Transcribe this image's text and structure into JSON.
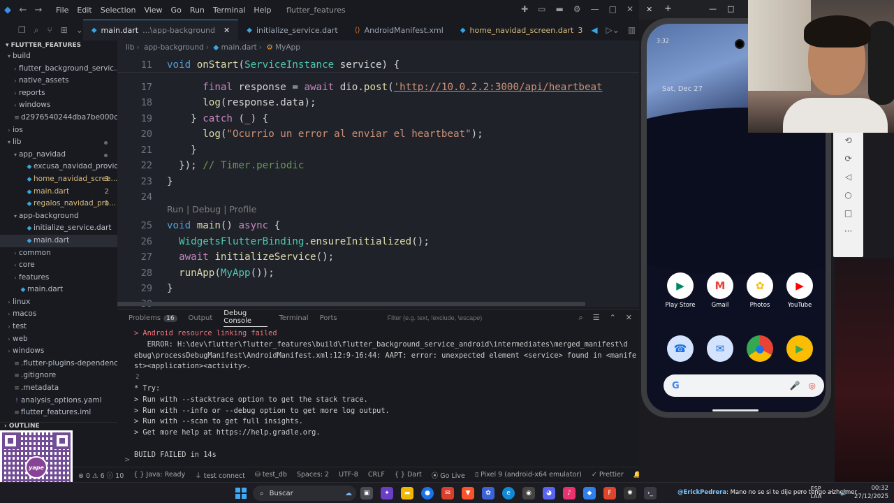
{
  "titlebar": {
    "menus": [
      "File",
      "Edit",
      "Selection",
      "View",
      "Go",
      "Run",
      "Terminal",
      "Help"
    ],
    "window_title": "flutter_features"
  },
  "tabs": [
    {
      "name": "main.dart",
      "desc": "...\\app-background",
      "active": true,
      "icon": "dart"
    },
    {
      "name": "initialize_service.dart",
      "icon": "dart"
    },
    {
      "name": "AndroidManifest.xml",
      "icon": "xml"
    },
    {
      "name": "home_navidad_screen.dart",
      "badge": "3",
      "icon": "dart"
    }
  ],
  "explorer": {
    "title": "FLUTTER_FEATURES",
    "outline": "OUTLINE",
    "items": [
      {
        "label": "build",
        "depth": 0,
        "type": "folder-open"
      },
      {
        "label": "flutter_background_servic...",
        "depth": 1,
        "type": "folder"
      },
      {
        "label": "native_assets",
        "depth": 1,
        "type": "folder"
      },
      {
        "label": "reports",
        "depth": 1,
        "type": "folder"
      },
      {
        "label": "windows",
        "depth": 1,
        "type": "folder"
      },
      {
        "label": "d2976540244dba7be000c4...",
        "depth": 0,
        "type": "file"
      },
      {
        "label": "ios",
        "depth": 0,
        "type": "folder"
      },
      {
        "label": "lib",
        "depth": 0,
        "type": "folder-open",
        "dot": true
      },
      {
        "label": "app_navidad",
        "depth": 1,
        "type": "folder-open",
        "dot": true
      },
      {
        "label": "excusa_navidad_provider....",
        "depth": 2,
        "type": "dart"
      },
      {
        "label": "home_navidad_scree...",
        "depth": 2,
        "type": "dart",
        "badge": "3",
        "warn": true
      },
      {
        "label": "main.dart",
        "depth": 2,
        "type": "dart",
        "badge": "2",
        "warn": true
      },
      {
        "label": "regalos_navidad_pro...",
        "depth": 2,
        "type": "dart",
        "badge": "1",
        "warn": true
      },
      {
        "label": "app-background",
        "depth": 1,
        "type": "folder-open"
      },
      {
        "label": "initialize_service.dart",
        "depth": 2,
        "type": "dart"
      },
      {
        "label": "main.dart",
        "depth": 2,
        "type": "dart",
        "selected": true
      },
      {
        "label": "common",
        "depth": 1,
        "type": "folder"
      },
      {
        "label": "core",
        "depth": 1,
        "type": "folder"
      },
      {
        "label": "features",
        "depth": 1,
        "type": "folder"
      },
      {
        "label": "main.dart",
        "depth": 1,
        "type": "dart"
      },
      {
        "label": "linux",
        "depth": 0,
        "type": "folder"
      },
      {
        "label": "macos",
        "depth": 0,
        "type": "folder"
      },
      {
        "label": "test",
        "depth": 0,
        "type": "folder"
      },
      {
        "label": "web",
        "depth": 0,
        "type": "folder"
      },
      {
        "label": "windows",
        "depth": 0,
        "type": "folder"
      },
      {
        "label": ".flutter-plugins-dependencies",
        "depth": 0,
        "type": "file"
      },
      {
        "label": ".gitignore",
        "depth": 0,
        "type": "file"
      },
      {
        "label": ".metadata",
        "depth": 0,
        "type": "file"
      },
      {
        "label": "analysis_options.yaml",
        "depth": 0,
        "type": "yaml"
      },
      {
        "label": "flutter_features.iml",
        "depth": 0,
        "type": "file"
      }
    ]
  },
  "breadcrumb": [
    "lib",
    "app-background",
    "main.dart",
    "MyApp"
  ],
  "editor": {
    "lines": [
      {
        "n": "17",
        "tokens": [
          [
            "      ",
            ""
          ],
          [
            "final",
            "kw"
          ],
          [
            " response = ",
            ""
          ],
          [
            "await",
            "kw"
          ],
          [
            " dio.",
            ""
          ],
          [
            "post",
            "fn"
          ],
          [
            "(",
            ""
          ],
          [
            "'http://10.0.2.2:3000/api/heartbeat",
            "str url"
          ]
        ]
      },
      {
        "n": "18",
        "tokens": [
          [
            "      ",
            ""
          ],
          [
            "log",
            "fn"
          ],
          [
            "(response.data);",
            ""
          ]
        ]
      },
      {
        "n": "19",
        "tokens": [
          [
            "    } ",
            ""
          ],
          [
            "catch",
            "kw"
          ],
          [
            " (_) {",
            ""
          ]
        ]
      },
      {
        "n": "20",
        "tokens": [
          [
            "      ",
            ""
          ],
          [
            "log",
            "fn"
          ],
          [
            "(",
            ""
          ],
          [
            "\"Ocurrio un error al enviar el heartbeat\"",
            "str"
          ],
          [
            ");",
            ""
          ]
        ]
      },
      {
        "n": "21",
        "tokens": [
          [
            "    }",
            ""
          ]
        ]
      },
      {
        "n": "22",
        "tokens": [
          [
            "  }); ",
            ""
          ],
          [
            "// Timer.periodic",
            "cm"
          ]
        ]
      },
      {
        "n": "23",
        "tokens": [
          [
            "}",
            ""
          ]
        ]
      },
      {
        "n": "24",
        "tokens": []
      },
      {
        "n": "25",
        "tokens": [
          [
            "void",
            "kw2"
          ],
          [
            " ",
            ""
          ],
          [
            "main",
            "fn"
          ],
          [
            "() ",
            ""
          ],
          [
            "async",
            "kw"
          ],
          [
            " {",
            ""
          ]
        ]
      },
      {
        "n": "26",
        "tokens": [
          [
            "  ",
            ""
          ],
          [
            "WidgetsFlutterBinding",
            "ty"
          ],
          [
            ".",
            ""
          ],
          [
            "ensureInitialized",
            "fn"
          ],
          [
            "();",
            ""
          ]
        ]
      },
      {
        "n": "27",
        "tokens": [
          [
            "  ",
            ""
          ],
          [
            "await",
            "kw"
          ],
          [
            " ",
            ""
          ],
          [
            "initializeService",
            "fn"
          ],
          [
            "();",
            ""
          ]
        ]
      },
      {
        "n": "28",
        "tokens": [
          [
            "  ",
            ""
          ],
          [
            "runApp",
            "fn"
          ],
          [
            "(",
            ""
          ],
          [
            "MyApp",
            "ty"
          ],
          [
            "());",
            ""
          ]
        ]
      },
      {
        "n": "29",
        "tokens": [
          [
            "}",
            ""
          ]
        ]
      },
      {
        "n": "30",
        "tokens": []
      }
    ],
    "sticky": {
      "n": "11",
      "tokens": [
        [
          "void",
          "kw2"
        ],
        [
          " ",
          ""
        ],
        [
          "onStart",
          "fn"
        ],
        [
          "(",
          ""
        ],
        [
          "ServiceInstance",
          "ty"
        ],
        [
          " service) {",
          ""
        ]
      ]
    },
    "codelens": "Run | Debug | Profile"
  },
  "panel": {
    "tabs": [
      {
        "label": "Problems",
        "count": "16"
      },
      {
        "label": "Output"
      },
      {
        "label": "Debug Console",
        "active": true
      },
      {
        "label": "Terminal"
      },
      {
        "label": "Ports"
      }
    ],
    "filter_placeholder": "Filter (e.g. text, !exclude, \\escape)",
    "output": [
      {
        "text": "> Android resource linking failed",
        "cls": "red"
      },
      {
        "text": "   ERROR: H:\\dev\\flutter\\flutter_features\\build\\flutter_background_service_android\\intermediates\\merged_manifest\\d",
        "cls": ""
      },
      {
        "text": "ebug\\processDebugManifest\\AndroidManifest.xml:12:9-16:44: AAPT: error: unexpected element <service> found in <manife",
        "cls": "",
        "indent": true
      },
      {
        "text": "st><application><activity>.",
        "cls": "",
        "indent": true
      },
      {
        "text": "2",
        "cls": "num"
      },
      {
        "text": "* Try:",
        "cls": ""
      },
      {
        "text": "> Run with --stacktrace option to get the stack trace.",
        "cls": ""
      },
      {
        "text": "> Run with --info or --debug option to get more log output.",
        "cls": ""
      },
      {
        "text": "> Run with --scan to get full insights.",
        "cls": ""
      },
      {
        "text": "> Get more help at https://help.gradle.org.",
        "cls": ""
      },
      {
        "text": "",
        "cls": ""
      },
      {
        "text": "BUILD FAILED in 14s",
        "cls": ""
      }
    ],
    "prompt": ">"
  },
  "statusbar": {
    "problems": "⊗ 0  ⚠ 6  ⓘ 10",
    "java": "Java: Ready",
    "test_connect": "test connect",
    "test_db": "test_db",
    "spaces": "Spaces: 2",
    "encoding": "UTF-8",
    "eol": "CRLF",
    "language": "Dart",
    "golive": "Go Live",
    "device": "Pixel 9 (android-x64 emulator)",
    "prettier": "Prettier"
  },
  "emulator": {
    "status_time": "3:32",
    "date": "Sat, Dec 27",
    "apps_row1": [
      {
        "label": "Play Store",
        "color": "#1a73e8",
        "glyph": "▶"
      },
      {
        "label": "Gmail",
        "color": "#ffffff",
        "glyph": "M"
      },
      {
        "label": "Photos",
        "color": "#ffffff",
        "glyph": "✿"
      },
      {
        "label": "YouTube",
        "color": "#ff0000",
        "glyph": "▶"
      }
    ],
    "apps_row2": [
      {
        "label": "",
        "color": "#1a73e8",
        "glyph": "☎"
      },
      {
        "label": "",
        "color": "#1a73e8",
        "glyph": "✉"
      },
      {
        "label": "",
        "color": "#ffffff",
        "glyph": "●"
      },
      {
        "label": "",
        "color": "#fbbc04",
        "glyph": "▶"
      }
    ]
  },
  "qr": {
    "logo": "yape"
  },
  "taskbar": {
    "search": "Buscar",
    "ticker_user": "@ErickPedrera",
    "ticker_text": ": Mano no se si te dije pero tengo alzheimer",
    "lang": "ESP",
    "lang2": "LAA",
    "time": "00:32",
    "date": "27/12/2025"
  }
}
